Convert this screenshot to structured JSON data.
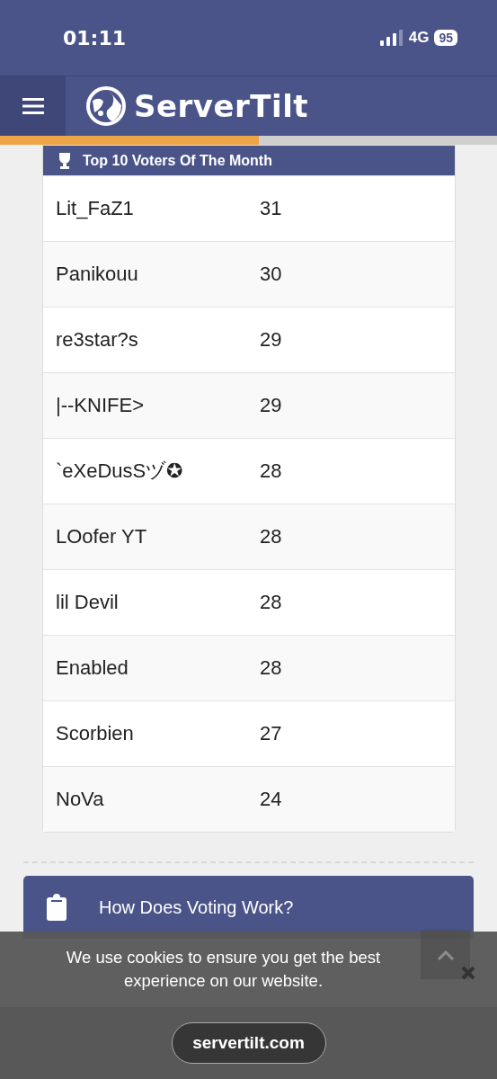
{
  "status_bar": {
    "time": "01:11",
    "network": "4G",
    "battery": "95"
  },
  "nav": {
    "brand": "ServerTilt",
    "reading_progress": {
      "level": 0.52
    }
  },
  "voters_card": {
    "title": "Top 10 Voters Of The Month",
    "rows": [
      {
        "name": "Lit_FaZ1",
        "votes": "31"
      },
      {
        "name": "Panikouu",
        "votes": "30"
      },
      {
        "name": "re3star?s",
        "votes": "29"
      },
      {
        "name": "|--KNIFE>",
        "votes": "29"
      },
      {
        "name": "`eXeDusSヅ✪",
        "votes": "28"
      },
      {
        "name": "LOofer YT",
        "votes": "28"
      },
      {
        "name": "lil Devil",
        "votes": "28"
      },
      {
        "name": "Enabled",
        "votes": "28"
      },
      {
        "name": "Scorbien",
        "votes": "27"
      },
      {
        "name": "NoVa",
        "votes": "24"
      }
    ]
  },
  "voting_card": {
    "title": "How Does Voting Work?"
  },
  "cookie_banner": {
    "message": "We use cookies to ensure you get the best experience on our website."
  },
  "browser_bar": {
    "url": "servertilt.com"
  }
}
